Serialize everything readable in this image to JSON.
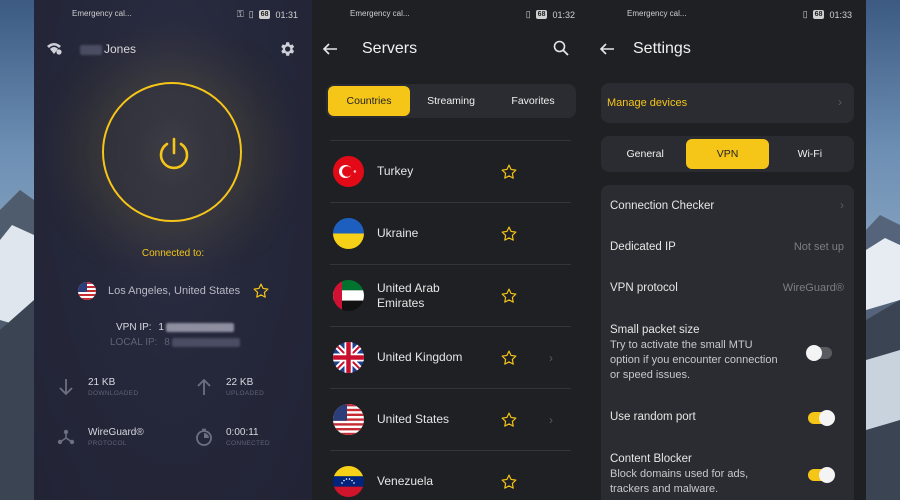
{
  "colors": {
    "accent": "#f5c518",
    "panel": "#2b2c31",
    "background_dark": "#1f2024"
  },
  "status_bars": [
    {
      "left": "Emergency cal...",
      "battery": "68",
      "time": "01:31"
    },
    {
      "left": "Emergency cal...",
      "battery": "68",
      "time": "01:32"
    },
    {
      "left": "Emergency cal...",
      "battery": "68",
      "time": "01:33"
    }
  ],
  "home": {
    "user_name": "Jones",
    "connected_label": "Connected to:",
    "location": "Los Angeles, United States",
    "vpn_ip_label": "VPN IP:",
    "vpn_ip_value": "1",
    "local_ip_label": "LOCAL IP:",
    "local_ip_value": "8",
    "downloaded_value": "21 KB",
    "downloaded_label": "DOWNLOADED",
    "uploaded_value": "22 KB",
    "uploaded_label": "UPLOADED",
    "protocol_value": "WireGuard®",
    "protocol_label": "PROTOCOL",
    "connected_time_value": "0:00:11",
    "connected_time_label": "CONNECTED"
  },
  "servers": {
    "title": "Servers",
    "tabs": [
      {
        "label": "Countries",
        "active": true
      },
      {
        "label": "Streaming",
        "active": false
      },
      {
        "label": "Favorites",
        "active": false
      }
    ],
    "items": [
      {
        "name": "Turkey",
        "flag": "turkey-flag-icon",
        "has_chevron": false
      },
      {
        "name": "Ukraine",
        "flag": "ukraine-flag-icon",
        "has_chevron": false
      },
      {
        "name": "United Arab Emirates",
        "flag": "uae-flag-icon",
        "has_chevron": false
      },
      {
        "name": "United Kingdom",
        "flag": "uk-flag-icon",
        "has_chevron": true
      },
      {
        "name": "United States",
        "flag": "us-flag-icon",
        "has_chevron": true
      },
      {
        "name": "Venezuela",
        "flag": "venezuela-flag-icon",
        "has_chevron": false
      }
    ]
  },
  "settings": {
    "title": "Settings",
    "manage_devices": "Manage devices",
    "tabs": [
      {
        "label": "General",
        "active": false
      },
      {
        "label": "VPN",
        "active": true
      },
      {
        "label": "Wi-Fi",
        "active": false
      }
    ],
    "connection_checker": "Connection Checker",
    "dedicated_ip_label": "Dedicated IP",
    "dedicated_ip_value": "Not set up",
    "vpn_protocol_label": "VPN protocol",
    "vpn_protocol_value": "WireGuard®",
    "small_packet_label": "Small packet size",
    "small_packet_desc": "Try to activate the small MTU option if you encounter connection or speed issues.",
    "small_packet_on": false,
    "random_port_label": "Use random port",
    "random_port_on": true,
    "content_blocker_label": "Content Blocker",
    "content_blocker_desc": "Block domains used for ads, trackers and malware.",
    "content_blocker_on": true
  }
}
